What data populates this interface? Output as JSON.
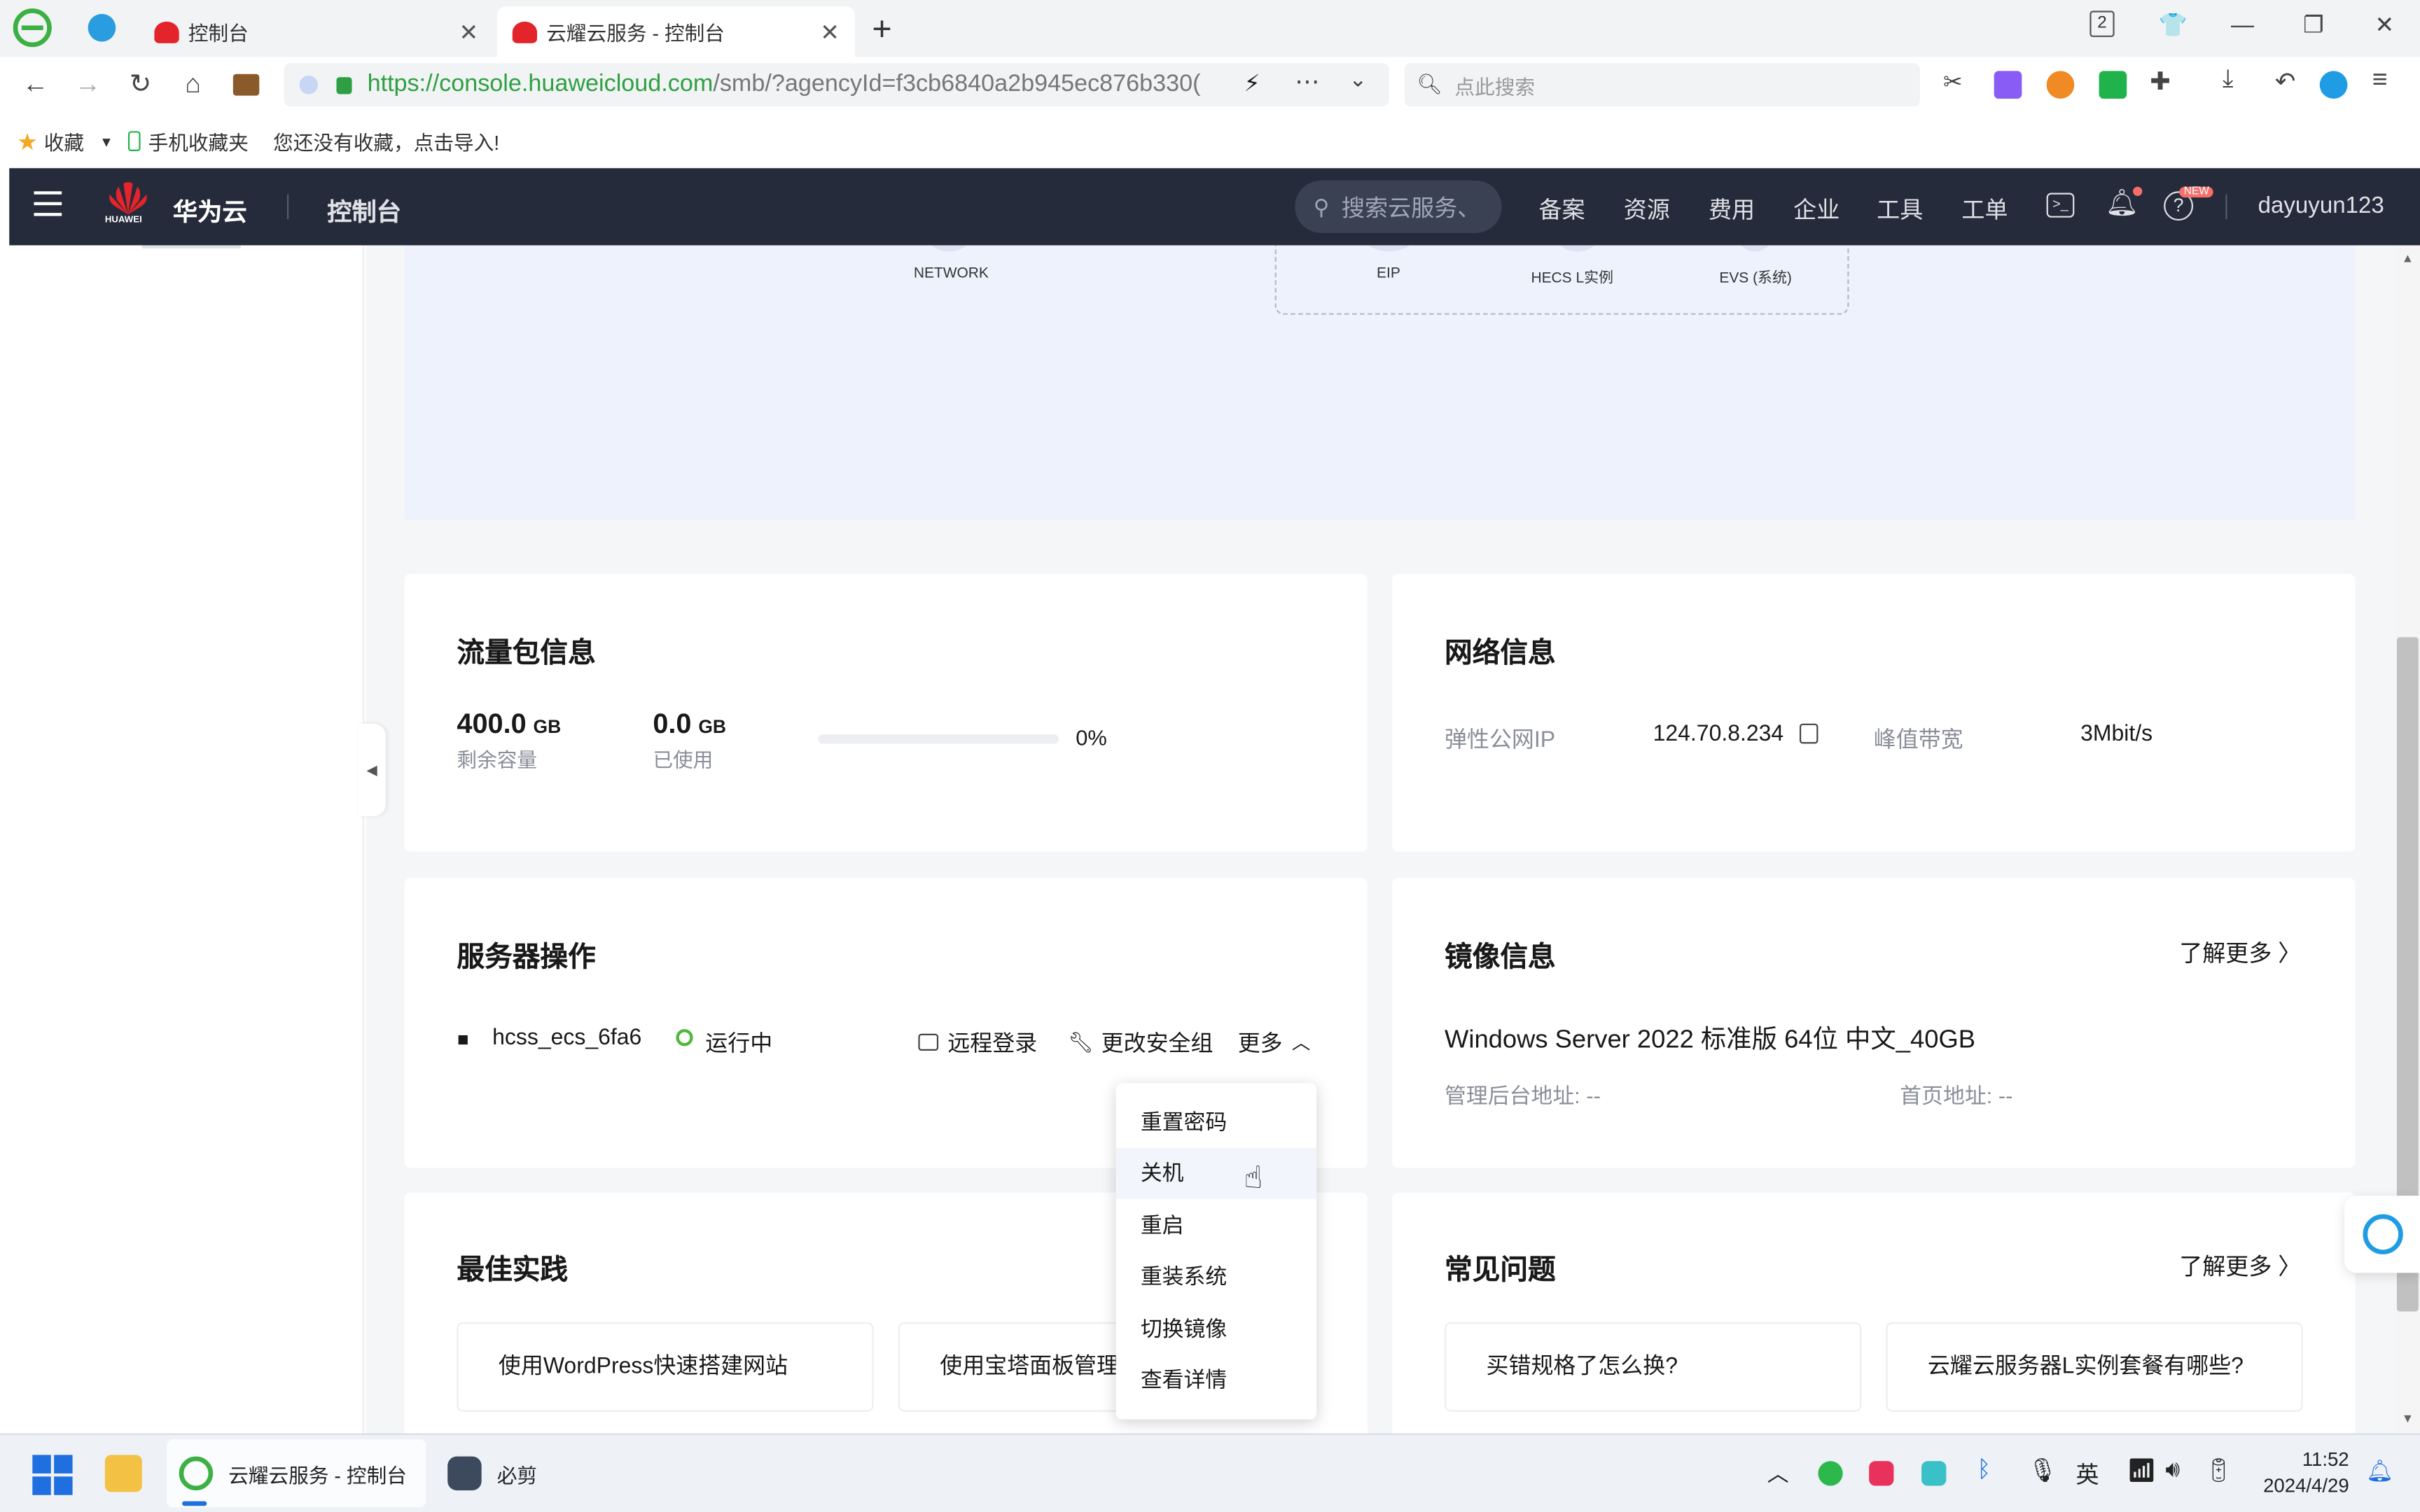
{
  "browser": {
    "tabs": [
      {
        "label": "控制台",
        "active": false
      },
      {
        "label": "云耀云服务 - 控制台",
        "active": true
      }
    ],
    "tab_count_badge": "2",
    "url_host": "https://console.huaweicloud.com",
    "url_path": "/smb/?agencyId=f3cb6840a2b945ec876b330(",
    "search_placeholder": "点此搜索",
    "bookmarks": {
      "favorites": "收藏",
      "mobile_favorites": "手机收藏夹",
      "hint": "您还没有收藏，点击导入!"
    }
  },
  "console_header": {
    "brand": "华为云",
    "brand_sub": "HUAWEI",
    "console": "控制台",
    "search_placeholder": "搜索云服务、",
    "nav": [
      "备案",
      "资源",
      "费用",
      "企业",
      "工具",
      "工单"
    ],
    "help_badge": "NEW",
    "username": "dayuyun123"
  },
  "diagram": {
    "labels": [
      "NETWORK",
      "EIP",
      "HECS L实例",
      "EVS (系统)"
    ]
  },
  "traffic": {
    "title": "流量包信息",
    "remaining_value": "400.0",
    "remaining_unit": "GB",
    "remaining_label": "剩余容量",
    "used_value": "0.0",
    "used_unit": "GB",
    "used_label": "已使用",
    "percent": "0%",
    "usage_fraction": 0
  },
  "network": {
    "title": "网络信息",
    "eip_label": "弹性公网IP",
    "eip_value": "124.70.8.234",
    "bandwidth_label": "峰值带宽",
    "bandwidth_value": "3Mbit/s"
  },
  "server_ops": {
    "title": "服务器操作",
    "server_name": "hcss_ecs_6fa6",
    "status": "运行中",
    "remote_login": "远程登录",
    "change_sg": "更改安全组",
    "more": "更多"
  },
  "more_menu": {
    "items": [
      "重置密码",
      "关机",
      "重启",
      "重装系统",
      "切换镜像",
      "查看详情"
    ],
    "hovered_index": 1
  },
  "image_info": {
    "title": "镜像信息",
    "learn_more": "了解更多",
    "os": "Windows Server 2022 标准版 64位 中文_40GB",
    "admin_label": "管理后台地址:",
    "admin_value": "--",
    "home_label": "首页地址:",
    "home_value": "--"
  },
  "best_practice": {
    "title": "最佳实践",
    "items": [
      "使用WordPress快速搭建网站",
      "使用宝塔面板管理"
    ]
  },
  "faq": {
    "title": "常见问题",
    "learn_more": "了解更多",
    "items": [
      "买错规格了怎么换?",
      "云耀云服务器L实例套餐有哪些?"
    ]
  },
  "taskbar": {
    "app1": "云耀云服务 - 控制台",
    "app2": "必剪",
    "ime": "英",
    "time": "11:52",
    "date": "2024/4/29"
  },
  "colors": {
    "console_header_bg": "#252b3a",
    "status_green": "#50b83c",
    "huawei_red": "#e3242b",
    "diagram_bg": "#eef2fd"
  }
}
